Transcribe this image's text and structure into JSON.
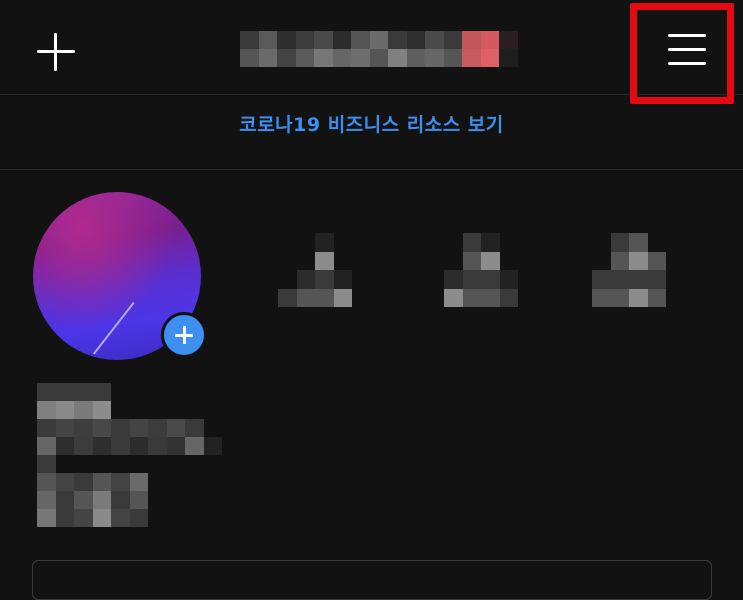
{
  "topbar": {
    "add_icon": "plus-icon",
    "menu_icon": "hamburger-menu-icon",
    "highlight_color": "#e50914"
  },
  "banner": {
    "covid_link": "코로나19 비즈니스 리소스 보기",
    "link_color": "#3d8ff0"
  },
  "profile": {
    "avatar_colors": [
      "#8a2a9e",
      "#4b36e8"
    ],
    "add_story_icon": "plus-circle-icon"
  }
}
